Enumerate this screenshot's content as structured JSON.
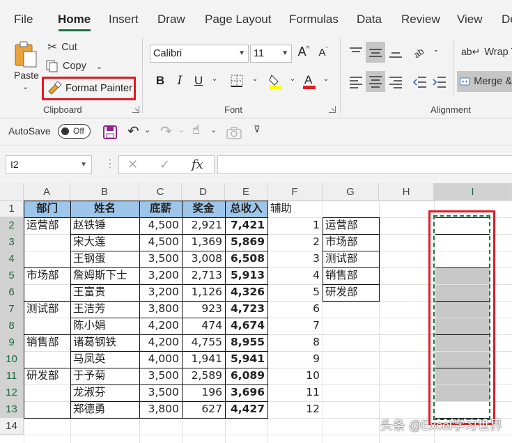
{
  "ribbon_tabs": [
    "File",
    "Home",
    "Insert",
    "Draw",
    "Page Layout",
    "Formulas",
    "Data",
    "Review",
    "View",
    "De"
  ],
  "clipboard": {
    "paste": "Paste",
    "cut": "Cut",
    "copy": "Copy",
    "format_painter": "Format Painter",
    "group_label": "Clipboard"
  },
  "font": {
    "name": "Calibri",
    "size": "11",
    "bold": "B",
    "italic": "I",
    "underline": "U",
    "group_label": "Font"
  },
  "alignment": {
    "wrap_text": "Wrap Te",
    "merge": "Merge &",
    "group_label": "Alignment"
  },
  "qat": {
    "autosave": "AutoSave",
    "toggle": "Off"
  },
  "formula_bar": {
    "name_box": "I2",
    "fx": "fx",
    "value": ""
  },
  "columns": [
    "A",
    "B",
    "C",
    "D",
    "E",
    "F",
    "G",
    "H",
    "I"
  ],
  "rows": [
    "1",
    "2",
    "3",
    "4",
    "5",
    "6",
    "7",
    "8",
    "9",
    "10",
    "11",
    "12",
    "13",
    "14"
  ],
  "headers": [
    "部门",
    "姓名",
    "底薪",
    "奖金",
    "总收入",
    "辅助"
  ],
  "table": [
    {
      "dept": "运营部",
      "name": "赵铁锤",
      "base": "4,500",
      "bonus": "2,921",
      "total": "7,421",
      "aux": "1",
      "g": "运营部"
    },
    {
      "dept": "",
      "name": "宋大莲",
      "base": "4,500",
      "bonus": "1,369",
      "total": "5,869",
      "aux": "2",
      "g": "市场部"
    },
    {
      "dept": "",
      "name": "王钢蛋",
      "base": "3,500",
      "bonus": "3,008",
      "total": "6,508",
      "aux": "3",
      "g": "测试部"
    },
    {
      "dept": "市场部",
      "name": "詹姆斯下士",
      "base": "3,200",
      "bonus": "2,713",
      "total": "5,913",
      "aux": "4",
      "g": "销售部"
    },
    {
      "dept": "",
      "name": "王富贵",
      "base": "3,200",
      "bonus": "1,126",
      "total": "4,326",
      "aux": "5",
      "g": "研发部"
    },
    {
      "dept": "测试部",
      "name": "王洁芳",
      "base": "3,800",
      "bonus": "923",
      "total": "4,723",
      "aux": "6",
      "g": ""
    },
    {
      "dept": "",
      "name": "陈小娟",
      "base": "4,200",
      "bonus": "474",
      "total": "4,674",
      "aux": "7",
      "g": ""
    },
    {
      "dept": "销售部",
      "name": "诸葛钢铁",
      "base": "4,200",
      "bonus": "4,755",
      "total": "8,955",
      "aux": "8",
      "g": ""
    },
    {
      "dept": "",
      "name": "马凤英",
      "base": "4,000",
      "bonus": "1,941",
      "total": "5,941",
      "aux": "9",
      "g": ""
    },
    {
      "dept": "研发部",
      "name": "于予菊",
      "base": "3,500",
      "bonus": "2,589",
      "total": "6,089",
      "aux": "10",
      "g": ""
    },
    {
      "dept": "",
      "name": "龙淑芬",
      "base": "3,500",
      "bonus": "196",
      "total": "3,696",
      "aux": "11",
      "g": ""
    },
    {
      "dept": "",
      "name": "郑德勇",
      "base": "3,800",
      "bonus": "627",
      "total": "4,427",
      "aux": "12",
      "g": ""
    }
  ],
  "colors": {
    "header_fill": "#9ec6ea",
    "highlight_border": "#e31b23",
    "excel_green": "#1e7145",
    "gray_fill": "#c8c8c8"
  },
  "watermark": "头条 @Excel学习世界"
}
